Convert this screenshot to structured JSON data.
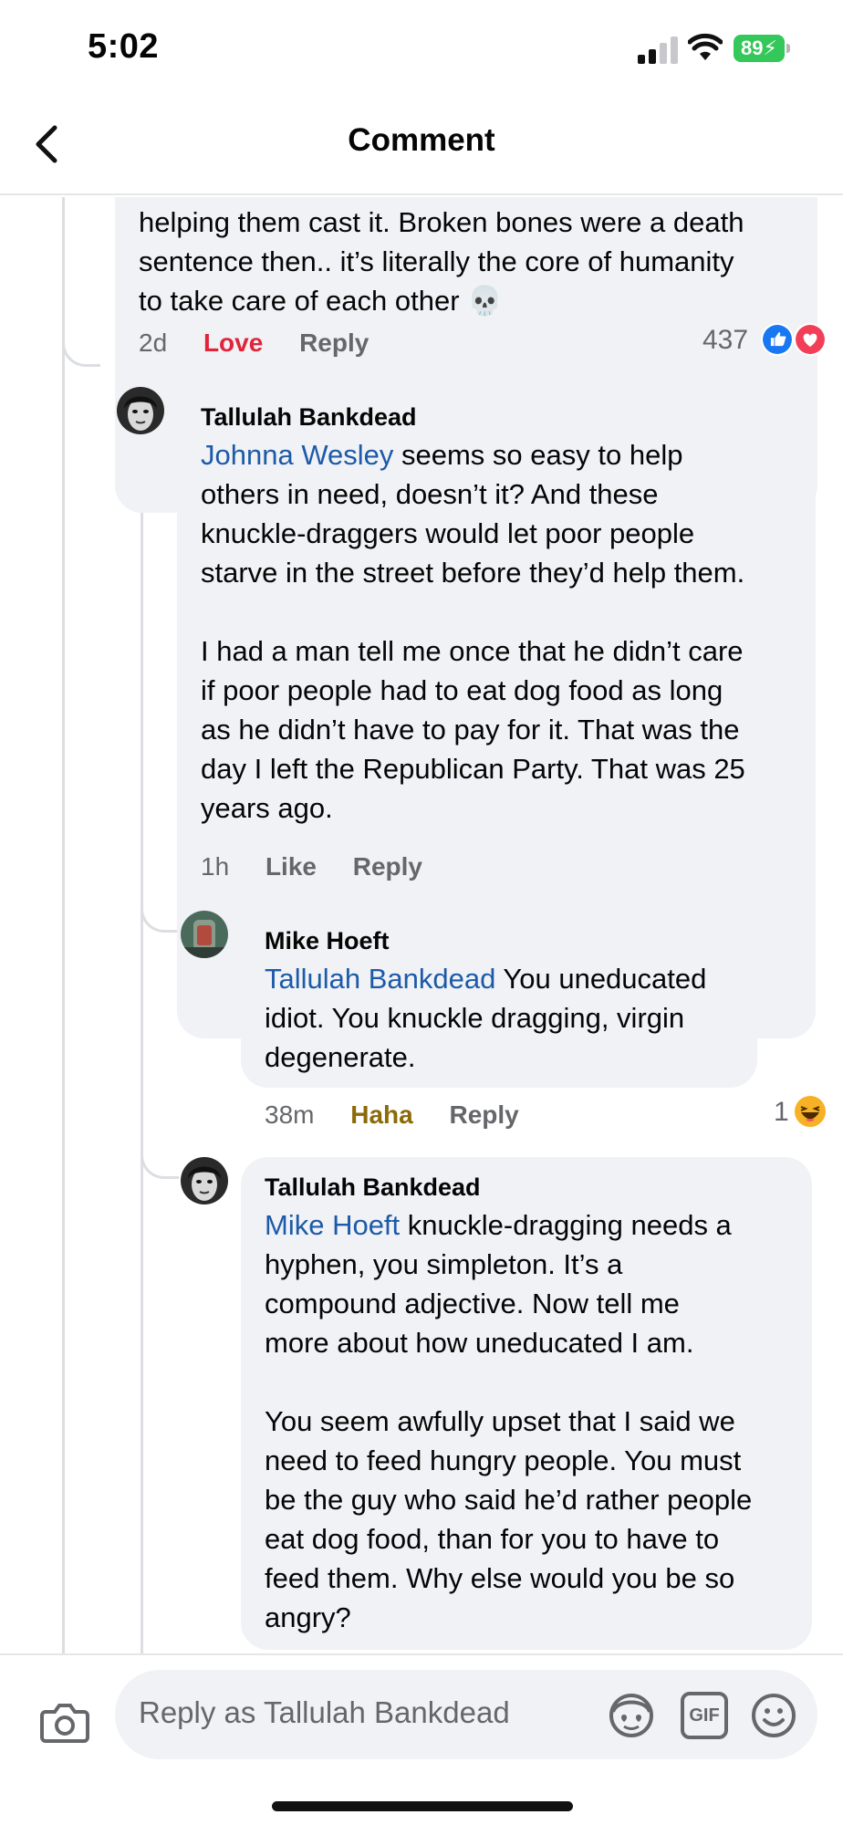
{
  "status_bar": {
    "time": "5:02",
    "battery": "89"
  },
  "header": {
    "title": "Comment"
  },
  "comments": [
    {
      "text_lines": [
        "helping them cast it. Broken bones were a death",
        "sentence then.. it’s literally the core of humanity",
        "to take care of each other 💀"
      ],
      "time": "2d",
      "reaction_action": "Love",
      "reply": "Reply",
      "reaction_count": "437",
      "reaction_icons": [
        "like-icon",
        "love-icon"
      ]
    },
    {
      "author": "Tallulah Bankdead",
      "mention": "Johnna Wesley",
      "first_line_rest": " seems so easy to help",
      "lines_1": [
        "others in need, doesn’t it?  And these",
        "knuckle-draggers would let poor people",
        "starve in the street before they’d help them."
      ],
      "lines_2": [
        "I had a man tell me once that he didn’t care",
        "if poor people had to eat dog food as long",
        "as he didn’t have to pay for it. That was the",
        "day I left the Republican Party.  That was 25",
        "years ago."
      ],
      "time": "1h",
      "reaction_action": "Like",
      "reply": "Reply"
    },
    {
      "author": "Mike Hoeft",
      "mention": "Tallulah Bankdead",
      "first_line_rest": " You uneducated",
      "lines_1": [
        "idiot. You knuckle dragging, virgin",
        "degenerate."
      ],
      "time": "38m",
      "reaction_action": "Haha",
      "reply": "Reply",
      "reaction_count": "1",
      "reaction_icons": [
        "haha-icon"
      ]
    },
    {
      "author": "Tallulah Bankdead",
      "mention": "Mike Hoeft",
      "first_line_rest": " knuckle-dragging needs a",
      "lines_1": [
        "hyphen, you simpleton.  It’s a",
        "compound adjective.  Now tell me",
        "more about how uneducated I am."
      ],
      "lines_2": [
        "You seem awfully upset that I said we",
        "need to feed hungry people.  You must",
        "be the guy who said he’d rather people",
        "eat dog food, than for you to have to",
        "feed them.   Why else would you be so",
        "angry?"
      ]
    }
  ],
  "composer": {
    "placeholder": "Reply as Tallulah Bankdead",
    "icons": [
      "camera-icon",
      "avatar-sticker-icon",
      "gif-icon",
      "emoji-icon"
    ],
    "gif_label": "GIF"
  },
  "colors": {
    "mention": "#1d5aa8",
    "love": "#e0243a",
    "haha": "#8b6a09",
    "bubble": "#f0f2f5",
    "like_blue": "#1877f2"
  }
}
